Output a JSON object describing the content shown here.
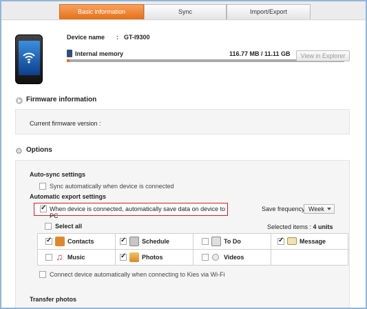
{
  "tabs": [
    {
      "label": "Basic information",
      "active": true
    },
    {
      "label": "Sync",
      "active": false
    },
    {
      "label": "Import/Export",
      "active": false
    }
  ],
  "device": {
    "name_label": "Device name",
    "name_sep": ":",
    "name_value": "GT-I9300",
    "memory_label": "Internal memory",
    "memory_usage": "116.77 MB / 11.11 GB",
    "memory_used_fraction": 0.0103,
    "view_explorer_button": "View in Explorer"
  },
  "firmware": {
    "title": "Firmware information",
    "current_label": "Current firmware version :"
  },
  "options": {
    "title": "Options",
    "autosync_title": "Auto-sync settings",
    "autosync_checkbox": "Sync automatically when device is connected",
    "autosync_checked": false,
    "auto_export_title": "Automatic export settings",
    "auto_export_checkbox": "When device is connected, automatically save data on device to PC",
    "auto_export_checked": true,
    "save_frequency_label": "Save frequency:",
    "save_frequency_value": "Week",
    "select_all_label": "Select all",
    "selected_items_prefix": "Selected items : ",
    "selected_items_count": "4 units",
    "items": [
      {
        "label": "Contacts",
        "checked": true,
        "icon": "contacts-icon"
      },
      {
        "label": "Schedule",
        "checked": true,
        "icon": "schedule-icon"
      },
      {
        "label": "To Do",
        "checked": false,
        "icon": "todo-icon"
      },
      {
        "label": "Message",
        "checked": true,
        "icon": "message-icon"
      },
      {
        "label": "Music",
        "checked": false,
        "icon": "music-icon"
      },
      {
        "label": "Photos",
        "checked": true,
        "icon": "photos-icon"
      },
      {
        "label": "Videos",
        "checked": false,
        "icon": "videos-icon"
      }
    ],
    "wifi_checkbox": "Connect device automatically when connecting to Kies via Wi-Fi",
    "wifi_checked": false,
    "transfer_photos_title": "Transfer photos"
  },
  "colors": {
    "accent": "#e66f16",
    "highlight_border": "#cc1f1f",
    "window_border": "#8fb6d8"
  }
}
